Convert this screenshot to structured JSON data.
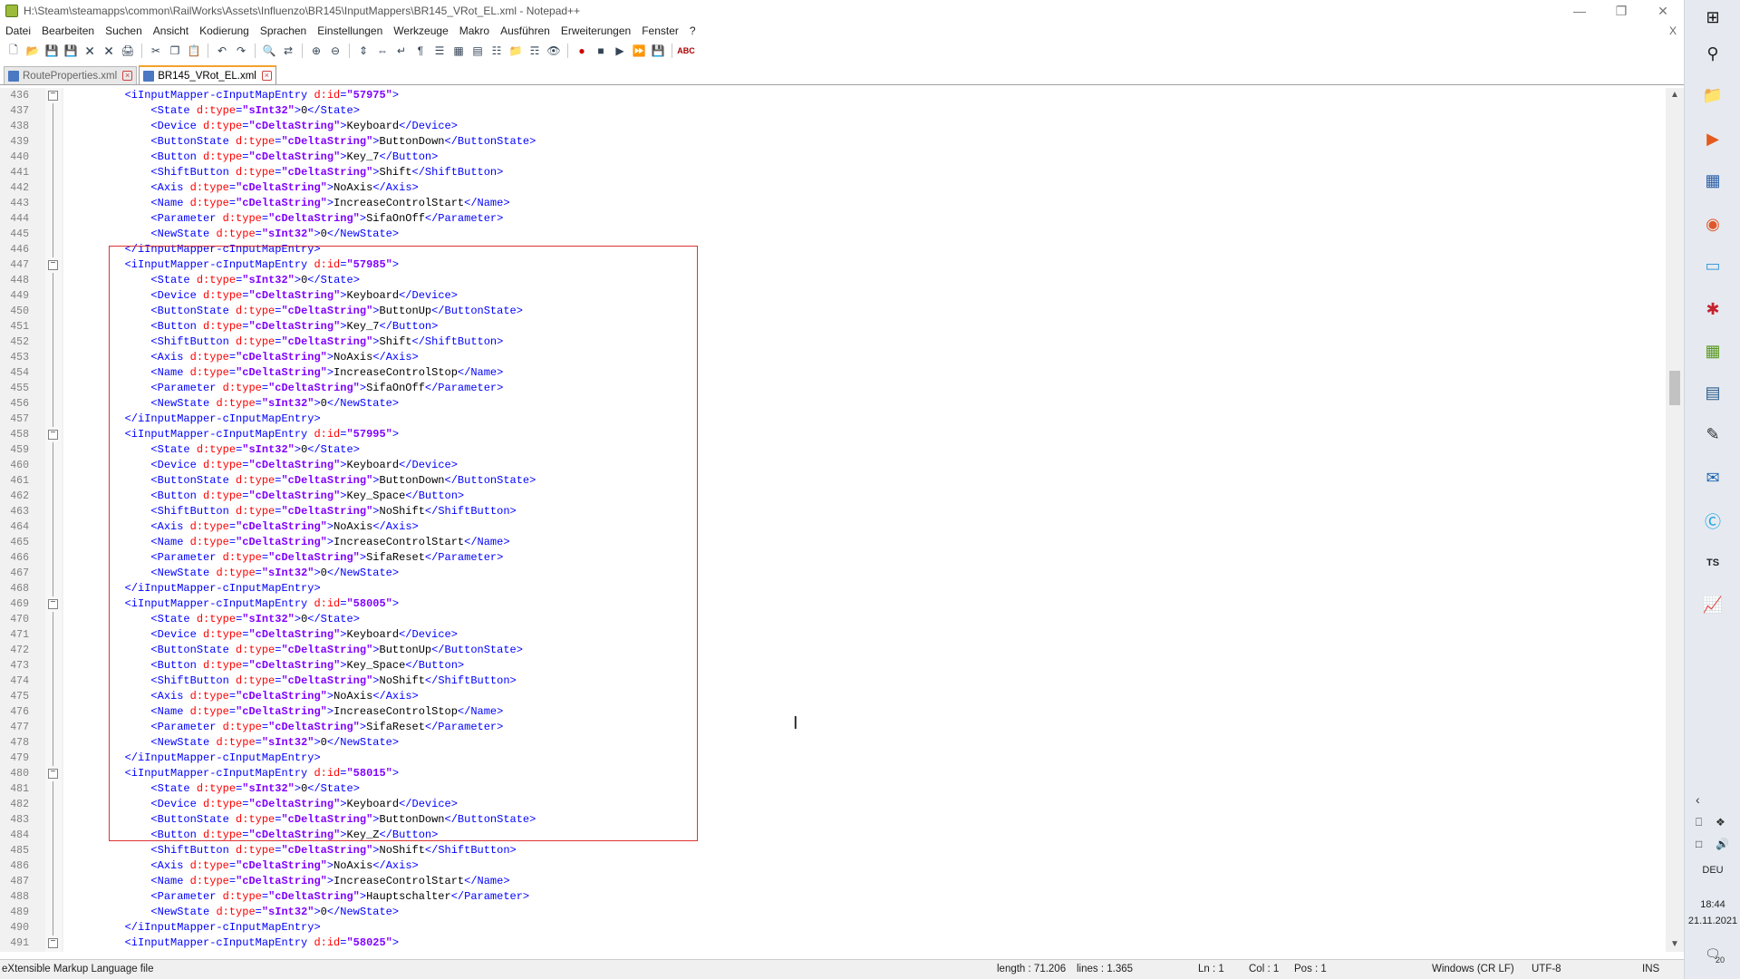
{
  "window": {
    "title": "H:\\Steam\\steamapps\\common\\RailWorks\\Assets\\Influenzo\\BR145\\InputMappers\\BR145_VRot_EL.xml - Notepad++",
    "close_doc": "X"
  },
  "menu": [
    "Datei",
    "Bearbeiten",
    "Suchen",
    "Ansicht",
    "Kodierung",
    "Sprachen",
    "Einstellungen",
    "Werkzeuge",
    "Makro",
    "Ausführen",
    "Erweiterungen",
    "Fenster",
    "?"
  ],
  "tabs": [
    {
      "label": "RouteProperties.xml",
      "active": false
    },
    {
      "label": "BR145_VRot_EL.xml",
      "active": true
    }
  ],
  "editor": {
    "lines": [
      {
        "n": "436",
        "fold": "open",
        "indent": 2,
        "kind": "open",
        "id": "57975"
      },
      {
        "n": "437",
        "indent": 3,
        "kind": "el",
        "tag": "State",
        "type": "sInt32",
        "value": "0"
      },
      {
        "n": "438",
        "indent": 3,
        "kind": "el",
        "tag": "Device",
        "type": "cDeltaString",
        "value": "Keyboard"
      },
      {
        "n": "439",
        "indent": 3,
        "kind": "el",
        "tag": "ButtonState",
        "type": "cDeltaString",
        "value": "ButtonDown"
      },
      {
        "n": "440",
        "indent": 3,
        "kind": "el",
        "tag": "Button",
        "type": "cDeltaString",
        "value": "Key_7"
      },
      {
        "n": "441",
        "indent": 3,
        "kind": "el",
        "tag": "ShiftButton",
        "type": "cDeltaString",
        "value": "Shift"
      },
      {
        "n": "442",
        "indent": 3,
        "kind": "el",
        "tag": "Axis",
        "type": "cDeltaString",
        "value": "NoAxis"
      },
      {
        "n": "443",
        "indent": 3,
        "kind": "el",
        "tag": "Name",
        "type": "cDeltaString",
        "value": "IncreaseControlStart"
      },
      {
        "n": "444",
        "indent": 3,
        "kind": "el",
        "tag": "Parameter",
        "type": "cDeltaString",
        "value": "SifaOnOff"
      },
      {
        "n": "445",
        "indent": 3,
        "kind": "el",
        "tag": "NewState",
        "type": "sInt32",
        "value": "0"
      },
      {
        "n": "446",
        "fold": "end",
        "indent": 2,
        "kind": "close"
      },
      {
        "n": "447",
        "fold": "open",
        "indent": 2,
        "kind": "open",
        "id": "57985"
      },
      {
        "n": "448",
        "indent": 3,
        "kind": "el",
        "tag": "State",
        "type": "sInt32",
        "value": "0"
      },
      {
        "n": "449",
        "indent": 3,
        "kind": "el",
        "tag": "Device",
        "type": "cDeltaString",
        "value": "Keyboard"
      },
      {
        "n": "450",
        "indent": 3,
        "kind": "el",
        "tag": "ButtonState",
        "type": "cDeltaString",
        "value": "ButtonUp"
      },
      {
        "n": "451",
        "indent": 3,
        "kind": "el",
        "tag": "Button",
        "type": "cDeltaString",
        "value": "Key_7"
      },
      {
        "n": "452",
        "indent": 3,
        "kind": "el",
        "tag": "ShiftButton",
        "type": "cDeltaString",
        "value": "Shift"
      },
      {
        "n": "453",
        "indent": 3,
        "kind": "el",
        "tag": "Axis",
        "type": "cDeltaString",
        "value": "NoAxis"
      },
      {
        "n": "454",
        "indent": 3,
        "kind": "el",
        "tag": "Name",
        "type": "cDeltaString",
        "value": "IncreaseControlStop"
      },
      {
        "n": "455",
        "indent": 3,
        "kind": "el",
        "tag": "Parameter",
        "type": "cDeltaString",
        "value": "SifaOnOff"
      },
      {
        "n": "456",
        "indent": 3,
        "kind": "el",
        "tag": "NewState",
        "type": "sInt32",
        "value": "0"
      },
      {
        "n": "457",
        "fold": "end",
        "indent": 2,
        "kind": "close"
      },
      {
        "n": "458",
        "fold": "open",
        "indent": 2,
        "kind": "open",
        "id": "57995"
      },
      {
        "n": "459",
        "indent": 3,
        "kind": "el",
        "tag": "State",
        "type": "sInt32",
        "value": "0"
      },
      {
        "n": "460",
        "indent": 3,
        "kind": "el",
        "tag": "Device",
        "type": "cDeltaString",
        "value": "Keyboard"
      },
      {
        "n": "461",
        "indent": 3,
        "kind": "el",
        "tag": "ButtonState",
        "type": "cDeltaString",
        "value": "ButtonDown"
      },
      {
        "n": "462",
        "indent": 3,
        "kind": "el",
        "tag": "Button",
        "type": "cDeltaString",
        "value": "Key_Space"
      },
      {
        "n": "463",
        "indent": 3,
        "kind": "el",
        "tag": "ShiftButton",
        "type": "cDeltaString",
        "value": "NoShift"
      },
      {
        "n": "464",
        "indent": 3,
        "kind": "el",
        "tag": "Axis",
        "type": "cDeltaString",
        "value": "NoAxis"
      },
      {
        "n": "465",
        "indent": 3,
        "kind": "el",
        "tag": "Name",
        "type": "cDeltaString",
        "value": "IncreaseControlStart"
      },
      {
        "n": "466",
        "indent": 3,
        "kind": "el",
        "tag": "Parameter",
        "type": "cDeltaString",
        "value": "SifaReset"
      },
      {
        "n": "467",
        "indent": 3,
        "kind": "el",
        "tag": "NewState",
        "type": "sInt32",
        "value": "0"
      },
      {
        "n": "468",
        "fold": "end",
        "indent": 2,
        "kind": "close"
      },
      {
        "n": "469",
        "fold": "open",
        "indent": 2,
        "kind": "open",
        "id": "58005"
      },
      {
        "n": "470",
        "indent": 3,
        "kind": "el",
        "tag": "State",
        "type": "sInt32",
        "value": "0"
      },
      {
        "n": "471",
        "indent": 3,
        "kind": "el",
        "tag": "Device",
        "type": "cDeltaString",
        "value": "Keyboard"
      },
      {
        "n": "472",
        "indent": 3,
        "kind": "el",
        "tag": "ButtonState",
        "type": "cDeltaString",
        "value": "ButtonUp"
      },
      {
        "n": "473",
        "indent": 3,
        "kind": "el",
        "tag": "Button",
        "type": "cDeltaString",
        "value": "Key_Space"
      },
      {
        "n": "474",
        "indent": 3,
        "kind": "el",
        "tag": "ShiftButton",
        "type": "cDeltaString",
        "value": "NoShift"
      },
      {
        "n": "475",
        "indent": 3,
        "kind": "el",
        "tag": "Axis",
        "type": "cDeltaString",
        "value": "NoAxis"
      },
      {
        "n": "476",
        "indent": 3,
        "kind": "el",
        "tag": "Name",
        "type": "cDeltaString",
        "value": "IncreaseControlStop"
      },
      {
        "n": "477",
        "indent": 3,
        "kind": "el",
        "tag": "Parameter",
        "type": "cDeltaString",
        "value": "SifaReset"
      },
      {
        "n": "478",
        "indent": 3,
        "kind": "el",
        "tag": "NewState",
        "type": "sInt32",
        "value": "0"
      },
      {
        "n": "479",
        "fold": "end",
        "indent": 2,
        "kind": "close"
      },
      {
        "n": "480",
        "fold": "open",
        "indent": 2,
        "kind": "open",
        "id": "58015"
      },
      {
        "n": "481",
        "indent": 3,
        "kind": "el",
        "tag": "State",
        "type": "sInt32",
        "value": "0"
      },
      {
        "n": "482",
        "indent": 3,
        "kind": "el",
        "tag": "Device",
        "type": "cDeltaString",
        "value": "Keyboard"
      },
      {
        "n": "483",
        "indent": 3,
        "kind": "el",
        "tag": "ButtonState",
        "type": "cDeltaString",
        "value": "ButtonDown"
      },
      {
        "n": "484",
        "indent": 3,
        "kind": "el",
        "tag": "Button",
        "type": "cDeltaString",
        "value": "Key_Z"
      },
      {
        "n": "485",
        "indent": 3,
        "kind": "el",
        "tag": "ShiftButton",
        "type": "cDeltaString",
        "value": "NoShift"
      },
      {
        "n": "486",
        "indent": 3,
        "kind": "el",
        "tag": "Axis",
        "type": "cDeltaString",
        "value": "NoAxis"
      },
      {
        "n": "487",
        "indent": 3,
        "kind": "el",
        "tag": "Name",
        "type": "cDeltaString",
        "value": "IncreaseControlStart"
      },
      {
        "n": "488",
        "indent": 3,
        "kind": "el",
        "tag": "Parameter",
        "type": "cDeltaString",
        "value": "Hauptschalter"
      },
      {
        "n": "489",
        "indent": 3,
        "kind": "el",
        "tag": "NewState",
        "type": "sInt32",
        "value": "0"
      },
      {
        "n": "490",
        "fold": "end",
        "indent": 2,
        "kind": "close"
      },
      {
        "n": "491",
        "fold": "open",
        "indent": 2,
        "kind": "open",
        "id": "58025"
      }
    ]
  },
  "status": {
    "filetype": "eXtensible Markup Language file",
    "length": "length : 71.206",
    "lines": "lines : 1.365",
    "ln": "Ln : 1",
    "col": "Col : 1",
    "pos": "Pos : 1",
    "eol": "Windows (CR LF)",
    "encoding": "UTF-8",
    "mode": "INS"
  },
  "taskbar": {
    "language": "DEU",
    "time": "18:44",
    "date": "21.11.2021",
    "notification_count": "20"
  },
  "colors": {
    "tag": "#0000ff",
    "attr": "#ff0000",
    "value": "#8000ff",
    "selection_box": "#dd3333",
    "active_tab_accent": "#f5a12c"
  }
}
